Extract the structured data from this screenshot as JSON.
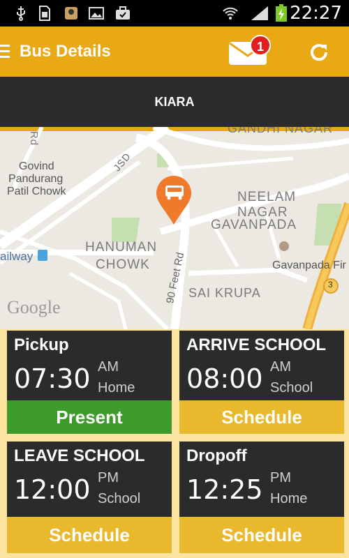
{
  "status_bar": {
    "time": "22:27",
    "icons": [
      "usb-icon",
      "sim-icon",
      "notification-icon",
      "image-icon",
      "briefcase-icon",
      "wifi-icon",
      "signal-icon",
      "battery-charging-icon"
    ]
  },
  "app_bar": {
    "title": "Bus Details",
    "notification_count": "1",
    "accent_color": "#e8a914"
  },
  "child": {
    "name": "KIARA"
  },
  "map": {
    "labels": [
      "Govind",
      "Pandurang",
      "Patil Chowk",
      "JSD",
      "NEELAM NAGAR",
      "GAVANPADA",
      "HANUMAN",
      "CHOWK",
      "ailway",
      "Gavanpada Fir",
      "90 Feet Rd",
      "SAI KRUPA",
      "GANDHI NAGAR",
      "Rd",
      "3"
    ],
    "logo": "Google"
  },
  "cards": [
    {
      "title": "Pickup",
      "time": "07:30",
      "meridiem": "AM",
      "place": "Home",
      "status": "Present"
    },
    {
      "title": "ARRIVE SCHOOL",
      "time": "08:00",
      "meridiem": "AM",
      "place": "School",
      "status": "Schedule"
    },
    {
      "title": "LEAVE SCHOOL",
      "time": "12:00",
      "meridiem": "PM",
      "place": "School",
      "status": "Schedule"
    },
    {
      "title": "Dropoff",
      "time": "12:25",
      "meridiem": "PM",
      "place": "Home",
      "status": "Schedule"
    }
  ],
  "colors": {
    "present": "#3e9a2b",
    "schedule": "#e8b82d",
    "card_bg": "#2b2b2b"
  }
}
